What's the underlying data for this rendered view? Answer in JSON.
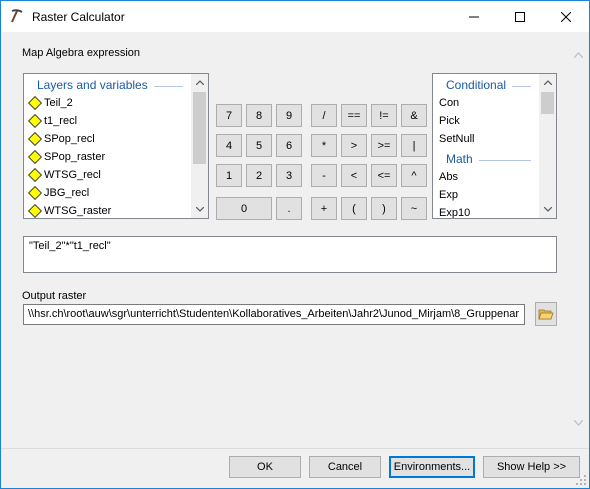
{
  "window": {
    "title": "Raster Calculator",
    "accent_color": "#1883d7"
  },
  "map_algebra": {
    "label": "Map Algebra expression"
  },
  "layers_list": {
    "header": "Layers and variables",
    "items": [
      "Teil_2",
      "t1_recl",
      "SPop_recl",
      "SPop_raster",
      "WTSG_recl",
      "JBG_recl",
      "WTSG_raster"
    ],
    "icon": "yellow-diamond-icon"
  },
  "calculator": {
    "rows": [
      [
        "7",
        "8",
        "9",
        "/",
        "==",
        "!=",
        "&"
      ],
      [
        "4",
        "5",
        "6",
        "*",
        ">",
        ">=",
        "|"
      ],
      [
        "1",
        "2",
        "3",
        "-",
        "<",
        "<=",
        "^"
      ],
      [
        "0",
        ".",
        "+",
        "(",
        ")",
        "~"
      ]
    ]
  },
  "functions_list": {
    "group_conditional": "Conditional",
    "conditional_items": [
      "Con",
      "Pick",
      "SetNull"
    ],
    "group_math": "Math",
    "math_items": [
      "Abs",
      "Exp",
      "Exp10"
    ]
  },
  "expression": {
    "value": "\"Teil_2\"*\"t1_recl\""
  },
  "output": {
    "label": "Output raster",
    "value": "\\\\hsr.ch\\root\\auw\\sgr\\unterricht\\Studenten\\Kollaboratives_Arbeiten\\Jahr2\\Junod_Mirjam\\8_Gruppenar"
  },
  "buttons": {
    "ok": "OK",
    "cancel": "Cancel",
    "environments": "Environments...",
    "show_help": "Show Help >>"
  }
}
